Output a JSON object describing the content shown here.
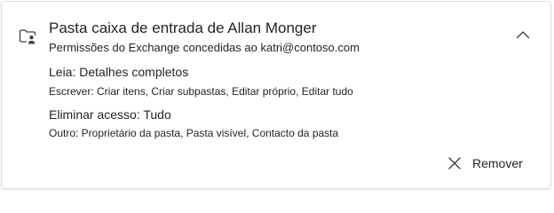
{
  "card": {
    "title": "Pasta caixa de entrada de Allan Monger",
    "subtitle": "Permissões do Exchange concedidas ao katri@contoso.com",
    "icons": {
      "folder": "folder-person-icon",
      "collapse": "chevron-up-icon",
      "remove": "close-icon"
    },
    "permissions": {
      "read": "Leia: Detalhes completos",
      "write": "Escrever: Criar itens, Criar subpastas, Editar próprio, Editar tudo",
      "delete": "Eliminar acesso: Tudo",
      "other": "Outro: Proprietário da pasta, Pasta visível, Contacto da pasta"
    },
    "remove_label": "Remover"
  },
  "colors": {
    "text": "#242424",
    "border": "#e1dfdd",
    "icon": "#424242"
  }
}
